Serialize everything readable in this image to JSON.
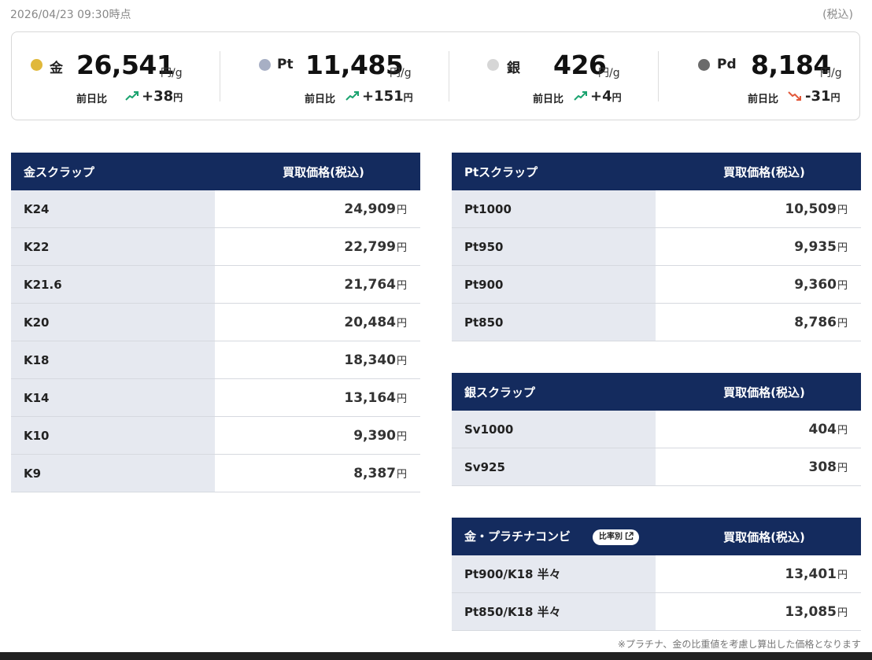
{
  "header": {
    "timestamp": "2026/04/23 09:30時点",
    "tax_note": "(税込)"
  },
  "metals": [
    {
      "dot_color": "#e0b83a",
      "name": "金",
      "price": "26,541",
      "unit": "円/g",
      "cmp_label": "前日比",
      "trend": "up",
      "change": "+38",
      "change_unit": "円"
    },
    {
      "dot_color": "#a7afc4",
      "name": "Pt",
      "price": "11,485",
      "unit": "円/g",
      "cmp_label": "前日比",
      "trend": "up",
      "change": "+151",
      "change_unit": "円"
    },
    {
      "dot_color": "#d6d6d6",
      "name": "銀",
      "price": "426",
      "unit": "円/g",
      "cmp_label": "前日比",
      "trend": "up",
      "change": "+4",
      "change_unit": "円"
    },
    {
      "dot_color": "#6b6b6b",
      "name": "Pd",
      "price": "8,184",
      "unit": "円/g",
      "cmp_label": "前日比",
      "trend": "down",
      "change": "-31",
      "change_unit": "円"
    }
  ],
  "colors": {
    "up": "#1aa36f",
    "down": "#e2583a",
    "table_header": "#142b5e",
    "label_bg": "#e6e9f0"
  },
  "gold_table": {
    "title": "金スクラップ",
    "price_header": "買取価格(税込)",
    "rows": [
      {
        "label": "K24",
        "value": "24,909",
        "unit": "円"
      },
      {
        "label": "K22",
        "value": "22,799",
        "unit": "円"
      },
      {
        "label": "K21.6",
        "value": "21,764",
        "unit": "円"
      },
      {
        "label": "K20",
        "value": "20,484",
        "unit": "円"
      },
      {
        "label": "K18",
        "value": "18,340",
        "unit": "円"
      },
      {
        "label": "K14",
        "value": "13,164",
        "unit": "円"
      },
      {
        "label": "K10",
        "value": "9,390",
        "unit": "円"
      },
      {
        "label": "K9",
        "value": "8,387",
        "unit": "円"
      }
    ]
  },
  "pt_table": {
    "title": "Ptスクラップ",
    "price_header": "買取価格(税込)",
    "rows": [
      {
        "label": "Pt1000",
        "value": "10,509",
        "unit": "円"
      },
      {
        "label": "Pt950",
        "value": "9,935",
        "unit": "円"
      },
      {
        "label": "Pt900",
        "value": "9,360",
        "unit": "円"
      },
      {
        "label": "Pt850",
        "value": "8,786",
        "unit": "円"
      }
    ]
  },
  "silver_table": {
    "title": "銀スクラップ",
    "price_header": "買取価格(税込)",
    "rows": [
      {
        "label": "Sv1000",
        "value": "404",
        "unit": "円"
      },
      {
        "label": "Sv925",
        "value": "308",
        "unit": "円"
      }
    ]
  },
  "combo_table": {
    "title": "金・プラチナコンビ",
    "ratio_button": "比率別",
    "price_header": "買取価格(税込)",
    "rows": [
      {
        "label": "Pt900/K18 半々",
        "value": "13,401",
        "unit": "円"
      },
      {
        "label": "Pt850/K18 半々",
        "value": "13,085",
        "unit": "円"
      }
    ]
  },
  "footnote": "※プラチナ、金の比重値を考慮し算出した価格となります"
}
